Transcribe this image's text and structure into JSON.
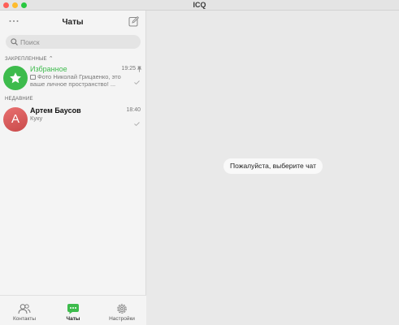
{
  "window": {
    "title": "ICQ"
  },
  "sidebar": {
    "title": "Чаты",
    "search": {
      "placeholder": "Поиск",
      "value": ""
    },
    "pinned_section": {
      "label": "ЗАКРЕПЛЕННЫЕ"
    },
    "recent_section": {
      "label": "НЕДАВНИЕ"
    },
    "chats": [
      {
        "name": "Избранное",
        "time": "19:25",
        "message": "Фото Николай Грицаенко, это ваше личное пространство! ...",
        "avatar": "star-icon",
        "pinned": true
      },
      {
        "name": "Артем Баусов",
        "time": "18:40",
        "message": "Куку",
        "avatar_letter": "А",
        "pinned": false
      }
    ]
  },
  "main": {
    "placeholder": "Пожалуйста, выберите чат"
  },
  "tabs": [
    {
      "label": "Контакты",
      "icon": "contacts-icon",
      "active": false
    },
    {
      "label": "Чаты",
      "icon": "chats-icon",
      "active": true
    },
    {
      "label": "Настройки",
      "icon": "settings-icon",
      "active": false
    }
  ],
  "colors": {
    "accent": "#3dbb4c",
    "avatar_red": "#d95757",
    "window_close": "#fe5f57",
    "window_minimize": "#febc2e",
    "window_zoom": "#28c840"
  }
}
